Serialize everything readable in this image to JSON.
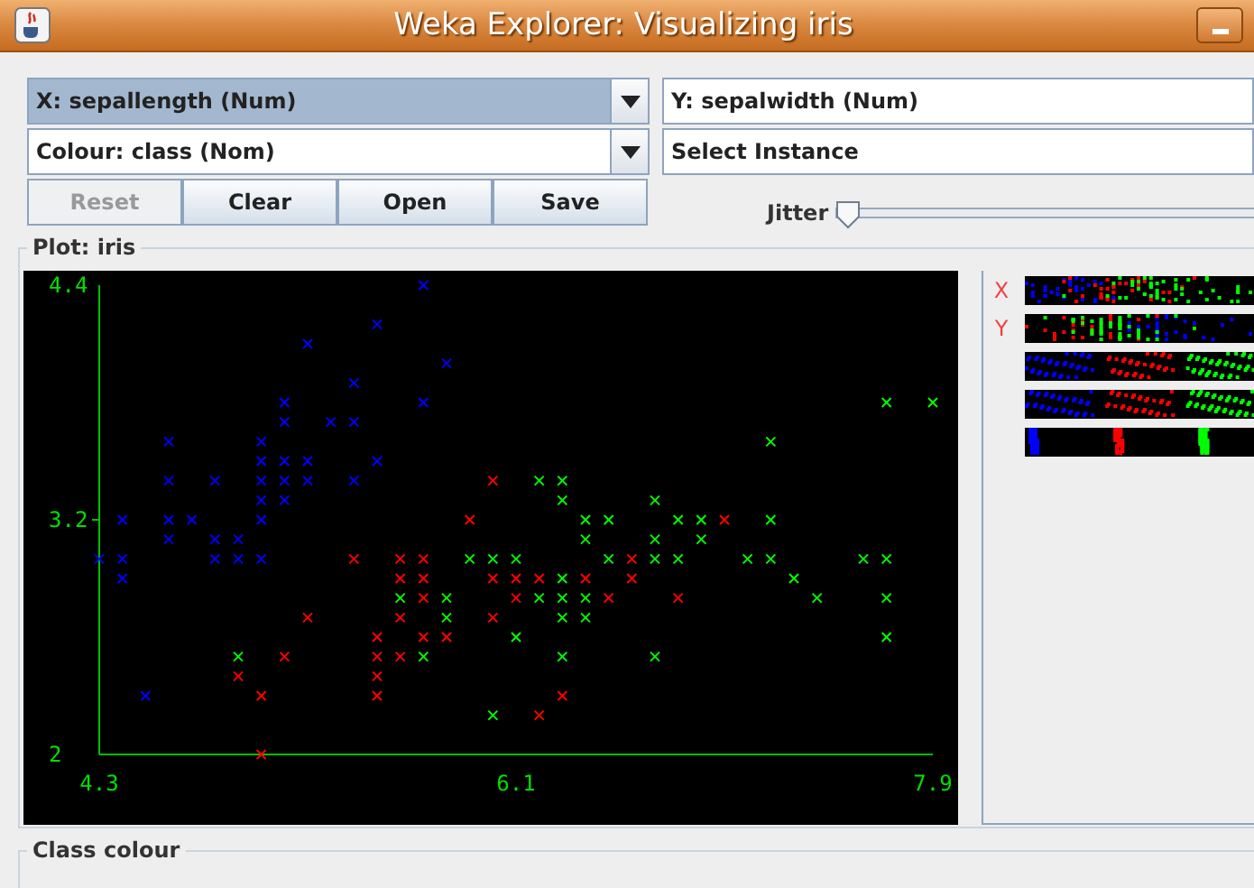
{
  "window": {
    "title": "Weka Explorer: Visualizing iris"
  },
  "combos": [
    {
      "label": "X: sepallength (Num)",
      "selected": true,
      "arrow": true
    },
    {
      "label": "Y: sepalwidth (Num)",
      "selected": false,
      "arrow": false
    },
    {
      "label": "Colour: class (Nom)",
      "selected": false,
      "arrow": true
    },
    {
      "label": "Select Instance",
      "selected": false,
      "arrow": false
    }
  ],
  "buttons": [
    {
      "label": "Reset",
      "disabled": true
    },
    {
      "label": "Clear",
      "disabled": false
    },
    {
      "label": "Open",
      "disabled": false
    },
    {
      "label": "Save",
      "disabled": false
    }
  ],
  "jitter": {
    "label": "Jitter",
    "level": 0
  },
  "plot": {
    "title": "Plot: iris",
    "chart_data": {
      "type": "scatter",
      "xlim": [
        4.3,
        7.9
      ],
      "ylim": [
        2,
        4.4
      ],
      "xticks": [
        {
          "value": 4.3,
          "label": "4.3"
        },
        {
          "value": 6.1,
          "label": "6.1"
        },
        {
          "value": 7.9,
          "label": "7.9"
        }
      ],
      "yticks": [
        {
          "value": 2,
          "label": "2"
        },
        {
          "value": 3.2,
          "label": "3.2"
        },
        {
          "value": 4.4,
          "label": "4.4"
        }
      ],
      "series": [
        {
          "color": "#0000ff",
          "x": [
            5.1,
            4.9,
            4.7,
            4.6,
            5.0,
            5.4,
            4.6,
            5.0,
            4.4,
            4.9,
            5.4,
            4.8,
            4.8,
            4.3,
            5.8,
            5.7,
            5.7,
            5.1,
            5.4,
            5.1,
            4.6,
            5.1,
            5.0,
            5.2,
            5.2,
            4.8,
            5.2,
            5.5,
            5.0,
            5.5,
            4.4,
            5.1,
            5.0,
            4.5,
            4.4,
            4.6,
            5.3,
            5.0
          ],
          "values": [
            3.5,
            3.0,
            3.2,
            3.1,
            3.6,
            3.9,
            3.4,
            3.4,
            2.9,
            3.1,
            3.7,
            3.4,
            3.0,
            3.0,
            4.0,
            4.4,
            3.8,
            3.8,
            3.4,
            3.7,
            3.6,
            3.3,
            3.0,
            3.5,
            3.4,
            3.1,
            4.1,
            4.2,
            3.2,
            3.5,
            3.0,
            3.4,
            3.5,
            2.3,
            3.2,
            3.2,
            3.7,
            3.3
          ]
        },
        {
          "color": "#ff0000",
          "x": [
            7.0,
            5.5,
            6.5,
            5.7,
            4.9,
            6.6,
            5.2,
            5.0,
            6.1,
            5.6,
            5.6,
            6.2,
            5.6,
            5.9,
            6.1,
            6.4,
            6.6,
            6.8,
            6.0,
            5.7,
            5.5,
            6.0,
            5.4,
            6.0,
            6.3,
            5.5,
            5.5,
            5.8,
            5.0,
            5.6,
            5.7,
            5.7,
            6.2,
            5.1
          ],
          "values": [
            3.2,
            2.3,
            2.8,
            2.8,
            2.4,
            2.9,
            2.7,
            2.0,
            2.9,
            2.9,
            3.0,
            2.2,
            2.5,
            3.2,
            2.8,
            2.9,
            3.0,
            2.8,
            2.9,
            2.6,
            2.4,
            2.7,
            3.0,
            3.4,
            2.3,
            2.5,
            2.6,
            2.6,
            2.3,
            2.7,
            3.0,
            2.9,
            2.9,
            2.5
          ]
        },
        {
          "color": "#00ff00",
          "x": [
            6.3,
            5.8,
            7.1,
            6.3,
            6.5,
            7.6,
            4.9,
            7.3,
            6.7,
            7.2,
            6.5,
            6.4,
            6.8,
            5.7,
            5.8,
            6.4,
            7.7,
            7.7,
            6.0,
            6.9,
            5.6,
            7.7,
            6.3,
            6.7,
            7.2,
            6.2,
            6.1,
            6.4,
            7.2,
            7.4,
            7.9,
            6.3,
            6.1,
            7.7,
            6.3,
            6.4,
            6.0,
            6.9,
            6.7,
            6.8,
            6.7,
            6.3,
            6.2,
            5.9
          ],
          "values": [
            3.3,
            2.7,
            3.0,
            2.9,
            3.0,
            3.0,
            2.5,
            2.9,
            2.5,
            3.6,
            3.2,
            2.7,
            3.0,
            2.5,
            2.8,
            3.2,
            3.8,
            2.6,
            2.2,
            3.2,
            2.8,
            2.8,
            2.7,
            3.3,
            3.2,
            2.8,
            3.0,
            2.8,
            3.0,
            2.8,
            3.8,
            2.8,
            2.6,
            3.0,
            3.4,
            3.1,
            3.0,
            3.1,
            3.1,
            3.2,
            3.0,
            2.5,
            3.4,
            3.0
          ]
        }
      ]
    }
  },
  "attribute_strips": [
    {
      "marker": "X",
      "kind": "numeric"
    },
    {
      "marker": "Y",
      "kind": "numeric"
    },
    {
      "kind": "numeric"
    },
    {
      "kind": "numeric"
    },
    {
      "kind": "nominal"
    }
  ],
  "class_colour": {
    "title": "Class colour"
  }
}
